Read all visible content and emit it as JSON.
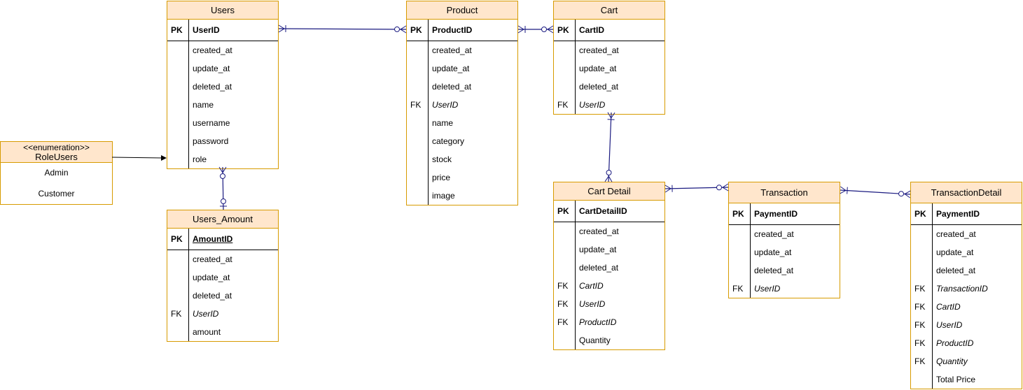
{
  "entities": [
    {
      "id": "users",
      "name": "Users",
      "pk": "UserID",
      "fields": [
        [
          "",
          "created_at"
        ],
        [
          "",
          "update_at"
        ],
        [
          "",
          "deleted_at"
        ],
        [
          "",
          "name"
        ],
        [
          "",
          "username"
        ],
        [
          "",
          "password"
        ],
        [
          "",
          "role"
        ]
      ]
    },
    {
      "id": "product",
      "name": "Product",
      "pk": "ProductID",
      "fields": [
        [
          "",
          "created_at"
        ],
        [
          "",
          "update_at"
        ],
        [
          "",
          "deleted_at"
        ],
        [
          "FK",
          "UserID"
        ],
        [
          "",
          "name"
        ],
        [
          "",
          "category"
        ],
        [
          "",
          "stock"
        ],
        [
          "",
          "price"
        ],
        [
          "",
          "image"
        ]
      ]
    },
    {
      "id": "cart",
      "name": "Cart",
      "pk": "CartID",
      "fields": [
        [
          "",
          "created_at"
        ],
        [
          "",
          "update_at"
        ],
        [
          "",
          "deleted_at"
        ],
        [
          "FK",
          "UserID"
        ]
      ]
    },
    {
      "id": "users-amount",
      "name": "Users_Amount",
      "pk": "AmountID",
      "pk_underlined": true,
      "fields": [
        [
          "",
          "created_at"
        ],
        [
          "",
          "update_at"
        ],
        [
          "",
          "deleted_at"
        ],
        [
          "FK",
          "UserID"
        ],
        [
          "",
          "amount"
        ]
      ]
    },
    {
      "id": "cart-detail",
      "name": "Cart Detail",
      "pk": "CartDetailID",
      "fields": [
        [
          "",
          "created_at"
        ],
        [
          "",
          "update_at"
        ],
        [
          "",
          "deleted_at"
        ],
        [
          "FK",
          "CartID"
        ],
        [
          "FK",
          "UserID"
        ],
        [
          "FK",
          "ProductID"
        ],
        [
          "",
          "Quantity"
        ]
      ]
    },
    {
      "id": "transaction",
      "name": "Transaction",
      "pk": "PaymentID",
      "fields": [
        [
          "",
          "created_at"
        ],
        [
          "",
          "update_at"
        ],
        [
          "",
          "deleted_at"
        ],
        [
          "FK",
          "UserID"
        ]
      ]
    },
    {
      "id": "transaction-detail",
      "name": "TransactionDetail",
      "pk": "PaymentID",
      "fields": [
        [
          "",
          "created_at"
        ],
        [
          "",
          "update_at"
        ],
        [
          "",
          "deleted_at"
        ],
        [
          "FK",
          "TransactionID"
        ],
        [
          "FK",
          "CartID"
        ],
        [
          "FK",
          "UserID"
        ],
        [
          "FK",
          "ProductID"
        ],
        [
          "FK",
          "Quantity"
        ],
        [
          "",
          "Total Price"
        ]
      ]
    }
  ],
  "pk_label": "PK",
  "enumeration": {
    "stereotype": "<<enumeration>>",
    "name": "RoleUsers",
    "values": [
      "Admin",
      "Customer"
    ]
  },
  "colors": {
    "header_fill": "#ffe6cc",
    "border": "#d79b00",
    "relation_line": "#1a1a80"
  }
}
